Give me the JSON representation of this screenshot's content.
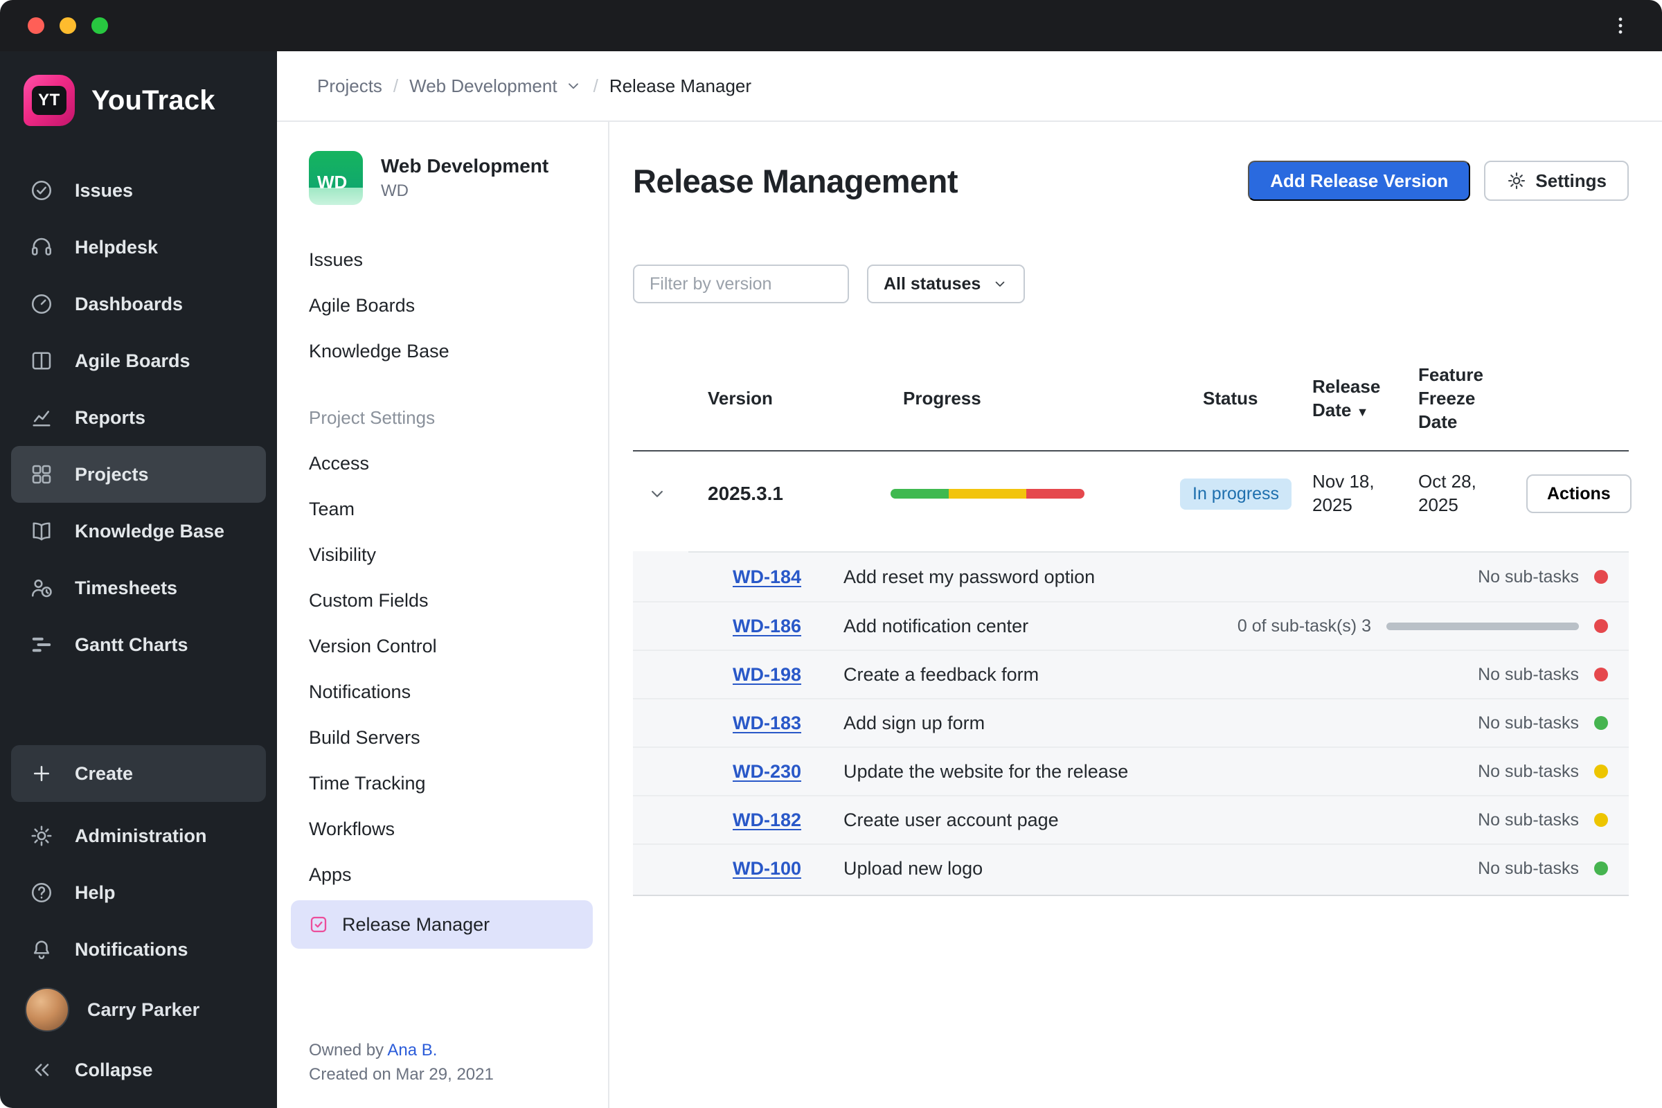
{
  "titlebar": {
    "menu_icon": "kebab-menu-icon"
  },
  "sidebar": {
    "product_name": "YouTrack",
    "logo_initials": "YT",
    "items": [
      {
        "label": "Issues",
        "icon": "issues-icon"
      },
      {
        "label": "Helpdesk",
        "icon": "helpdesk-icon"
      },
      {
        "label": "Dashboards",
        "icon": "dashboards-icon"
      },
      {
        "label": "Agile Boards",
        "icon": "agile-boards-icon"
      },
      {
        "label": "Reports",
        "icon": "reports-icon"
      },
      {
        "label": "Projects",
        "icon": "projects-icon",
        "active": true
      },
      {
        "label": "Knowledge Base",
        "icon": "knowledge-base-icon"
      },
      {
        "label": "Timesheets",
        "icon": "timesheets-icon"
      },
      {
        "label": "Gantt Charts",
        "icon": "gantt-charts-icon"
      }
    ],
    "create_label": "Create",
    "create_icon": "plus-icon",
    "bottom_items": [
      {
        "label": "Administration",
        "icon": "gear-icon"
      },
      {
        "label": "Help",
        "icon": "help-icon"
      },
      {
        "label": "Notifications",
        "icon": "bell-icon"
      }
    ],
    "user_name": "Carry Parker",
    "collapse_label": "Collapse",
    "collapse_icon": "collapse-icon"
  },
  "breadcrumb": {
    "root": "Projects",
    "project": "Web Development",
    "page": "Release Manager",
    "separator": "/"
  },
  "project_panel": {
    "avatar_text": "WD",
    "name": "Web Development",
    "key": "WD",
    "nav_items": [
      "Issues",
      "Agile Boards",
      "Knowledge Base"
    ],
    "settings_header": "Project Settings",
    "settings_items": [
      "Access",
      "Team",
      "Visibility",
      "Custom Fields",
      "Version Control",
      "Notifications",
      "Build Servers",
      "Time Tracking",
      "Workflows",
      "Apps"
    ],
    "selected_item": "Release Manager",
    "selected_icon": "checkbox-icon",
    "owned_by": "Owned by",
    "owner_link": "Ana B.",
    "created_line": "Created on Mar 29, 2021"
  },
  "main": {
    "title": "Release Management",
    "add_release_button": "Add Release Version",
    "settings_button": "Settings",
    "filter_placeholder": "Filter by version",
    "status_filter_value": "All statuses",
    "table": {
      "headers": {
        "version": "Version",
        "progress": "Progress",
        "status": "Status",
        "release_date": "Release Date",
        "freeze_date": "Feature Freeze Date",
        "sort_indicator": "▼"
      },
      "release": {
        "version": "2025.3.1",
        "status_badge": "In progress",
        "release_date": "Nov 18, 2025",
        "freeze_date": "Oct 28, 2025",
        "actions_button": "Actions",
        "progress_pct": {
          "green": 30,
          "yellow": 40,
          "red": 30
        }
      },
      "issues": [
        {
          "id": "WD-184",
          "summary": "Add reset my password option",
          "subtasks": "No sub-tasks",
          "dot": "red"
        },
        {
          "id": "WD-186",
          "summary": "Add notification center",
          "subtasks": "0 of sub-task(s) 3",
          "has_bar": true,
          "dot": "red"
        },
        {
          "id": "WD-198",
          "summary": "Create a feedback form",
          "subtasks": "No sub-tasks",
          "dot": "red"
        },
        {
          "id": "WD-183",
          "summary": "Add sign up form",
          "subtasks": "No sub-tasks",
          "dot": "green"
        },
        {
          "id": "WD-230",
          "summary": "Update the website for the release",
          "subtasks": "No sub-tasks",
          "dot": "yellow"
        },
        {
          "id": "WD-182",
          "summary": "Create user account page",
          "subtasks": "No sub-tasks",
          "dot": "yellow"
        },
        {
          "id": "WD-100",
          "summary": "Upload new logo",
          "subtasks": "No sub-tasks",
          "dot": "green"
        }
      ]
    }
  },
  "colors": {
    "accent_blue": "#2a6adf",
    "badge_bg": "#cfe7f8",
    "badge_text": "#1e6fae",
    "progress_green": "#3fb950",
    "progress_yellow": "#f2c40d",
    "progress_red": "#e5484d",
    "selected_nav_bg": "#dfe3fb",
    "sidebar_bg": "#1d2126",
    "issue_link_blue": "#2958c8",
    "logo_pink": "#ef2a86",
    "project_green": "#16b45f"
  }
}
